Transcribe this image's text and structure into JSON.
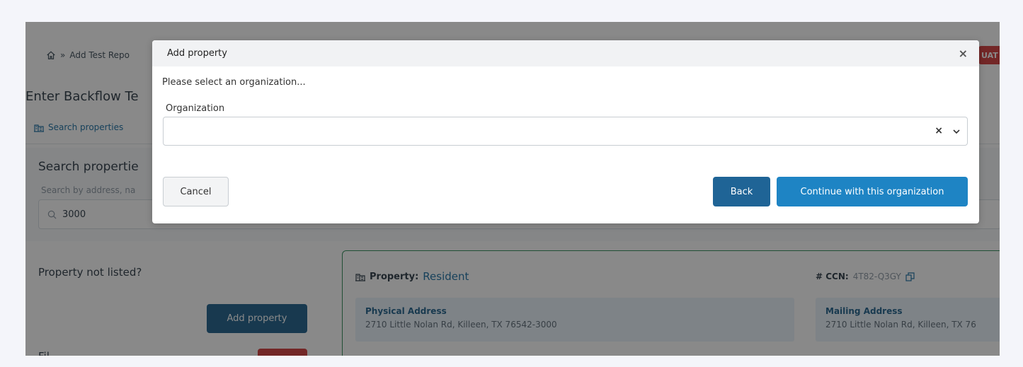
{
  "background": {
    "breadcrumb": {
      "home_icon": "home-icon",
      "separator": "»",
      "current": "Add Test Repo"
    },
    "env_badge": "UAT",
    "page_title": "Enter Backflow Te",
    "tab": {
      "icon": "building-icon",
      "label": "Search properties"
    },
    "search": {
      "title": "Search propertie",
      "hint": "Search by address, na",
      "value": "3000"
    },
    "property_not_listed": {
      "label": "Property not listed?",
      "button": "Add property"
    },
    "filter_label": "Fil",
    "property_card": {
      "property_label": "Property:",
      "property_value": "Resident",
      "ccn_label": "# CCN:",
      "ccn_value": "4T82-Q3GY",
      "physical_address_label": "Physical Address",
      "physical_address": "2710 Little Nolan Rd, Killeen, TX 76542-3000",
      "mailing_address_label": "Mailing Address",
      "mailing_address": "2710 Little Nolan Rd, Killeen, TX 76"
    }
  },
  "modal": {
    "title": "Add property",
    "close": "×",
    "prompt": "Please select an organization...",
    "field_label": "Organization",
    "select_value": "",
    "clear": "×",
    "buttons": {
      "cancel": "Cancel",
      "back": "Back",
      "continue": "Continue with this organization"
    }
  },
  "colors": {
    "primary": "#1e84c4",
    "back": "#1f6496",
    "badge": "#d23a3a",
    "accent_border": "#2e8b57"
  }
}
